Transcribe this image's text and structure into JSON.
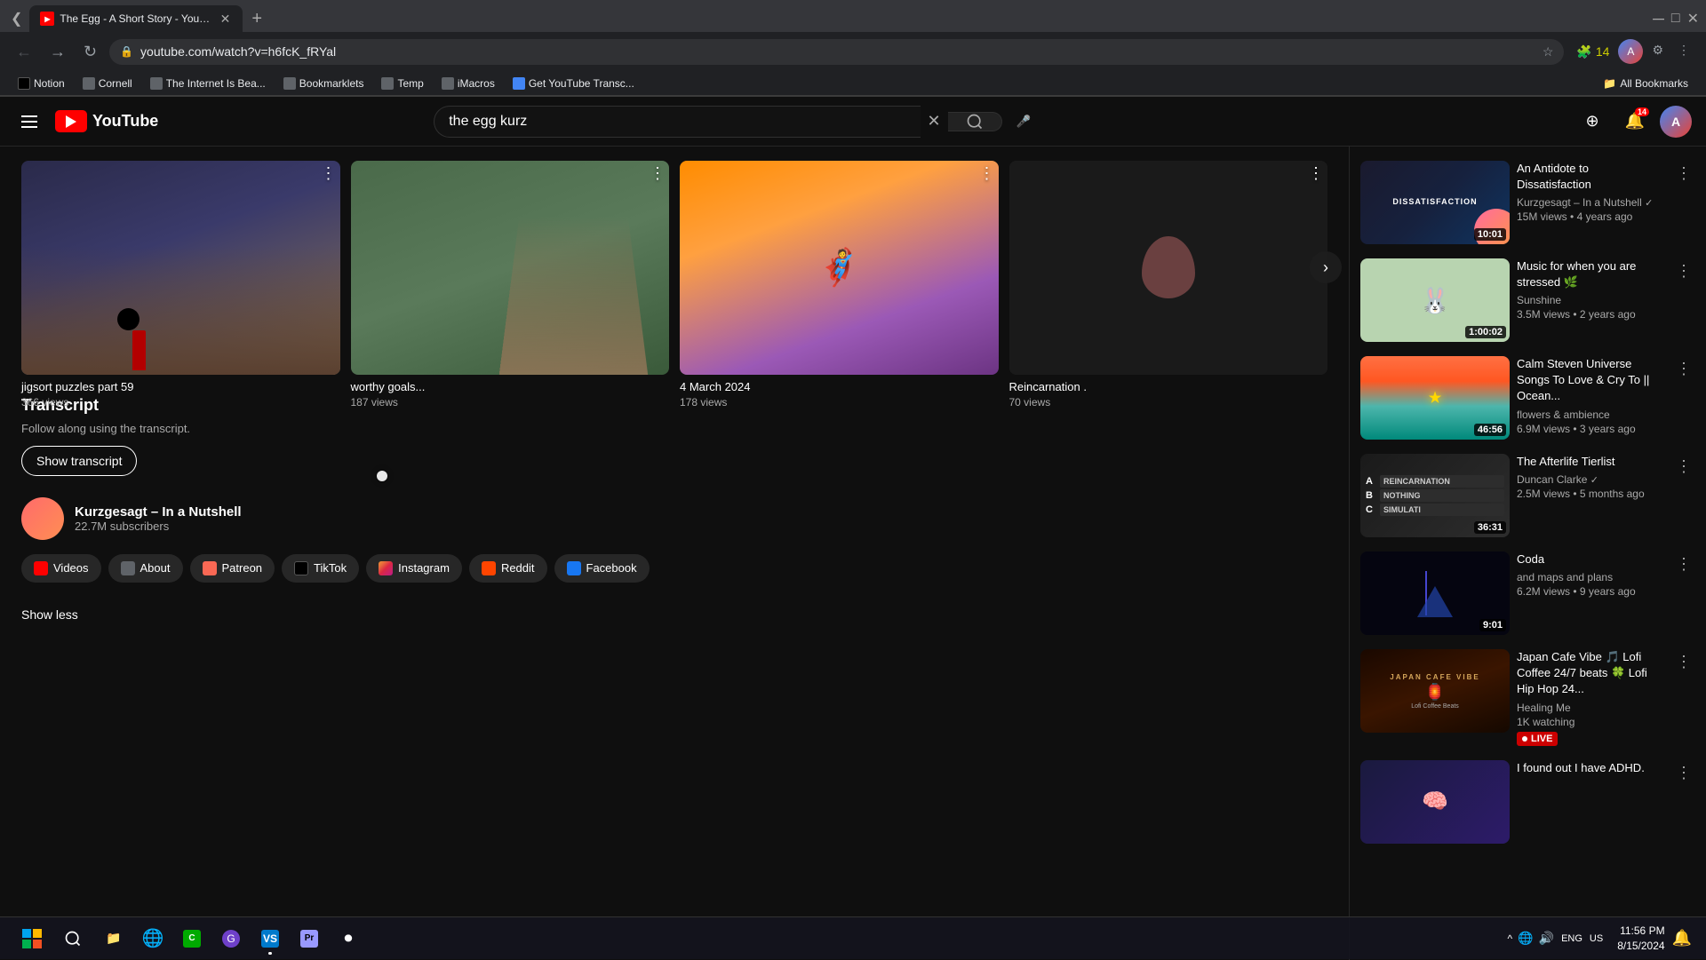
{
  "browser": {
    "tab_title": "The Egg - A Short Story - YouT...",
    "url": "youtube.com/watch?v=h6fcK_fRYal",
    "new_tab_label": "+",
    "bookmarks": [
      {
        "label": "Notion",
        "icon": "notion"
      },
      {
        "label": "Cornell",
        "icon": "folder"
      },
      {
        "label": "The Internet Is Bea...",
        "icon": "folder"
      },
      {
        "label": "Bookmarklets",
        "icon": "folder"
      },
      {
        "label": "Temp",
        "icon": "folder"
      },
      {
        "label": "iMacros",
        "icon": "folder"
      },
      {
        "label": "Get YouTube Transc...",
        "icon": "link"
      }
    ],
    "all_bookmarks_label": "All Bookmarks"
  },
  "youtube": {
    "search_query": "the egg kurz",
    "header_icons": {
      "create": "➕",
      "notifications": "🔔",
      "notification_count": "14",
      "avatar": "A"
    }
  },
  "thumbnails": [
    {
      "title": "jigsort puzzles part 59",
      "views": "366 views"
    },
    {
      "title": "worthy goals...",
      "views": "187 views"
    },
    {
      "title": "4 March 2024",
      "views": "178 views"
    },
    {
      "title": "Reincarnation .",
      "views": "70 views"
    }
  ],
  "transcript": {
    "title": "Transcript",
    "subtitle": "Follow along using the transcript.",
    "show_button": "Show transcript"
  },
  "channel": {
    "name": "Kurzgesagt – In a Nutshell",
    "subscribers": "22.7M subscribers",
    "links": [
      {
        "label": "Videos",
        "icon_class": "icon-videos"
      },
      {
        "label": "About",
        "icon_class": "icon-about"
      },
      {
        "label": "Patreon",
        "icon_class": "icon-patreon"
      },
      {
        "label": "TikTok",
        "icon_class": "icon-tiktok"
      },
      {
        "label": "Instagram",
        "icon_class": "icon-instagram"
      },
      {
        "label": "Reddit",
        "icon_class": "icon-reddit"
      },
      {
        "label": "Facebook",
        "icon_class": "icon-facebook"
      }
    ],
    "show_less_label": "Show less"
  },
  "sidebar_videos": [
    {
      "title": "An Antidote to Dissatisfaction",
      "channel": "Kurzgesagt – In a Nutshell",
      "verified": true,
      "views": "15M views",
      "age": "4 years ago",
      "duration": "10:01",
      "thumb_class": "dissatisfaction-thumb"
    },
    {
      "title": "Music for when you are stressed 🌿",
      "channel": "Sunshine",
      "verified": false,
      "views": "3.5M views",
      "age": "2 years ago",
      "duration": "1:00:02",
      "thumb_class": "stress-thumb"
    },
    {
      "title": "Calm Steven Universe Songs To Love & Cry To || Ocean...",
      "channel": "flowers & ambience",
      "verified": false,
      "views": "6.9M views",
      "age": "3 years ago",
      "duration": "46:56",
      "thumb_class": "steven-thumb"
    },
    {
      "title": "The Afterlife Tierlist",
      "channel": "Duncan Clarke",
      "verified": true,
      "views": "2.5M views",
      "age": "5 months ago",
      "duration": "36:31",
      "thumb_class": "afterlife-thumb"
    },
    {
      "title": "Coda",
      "channel": "and maps and plans",
      "verified": false,
      "views": "6.2M views",
      "age": "9 years ago",
      "duration": "9:01",
      "thumb_class": "coda-thumb"
    },
    {
      "title": "Japan Cafe Vibe 🎵 Lofi Coffee 24/7 beats 🍀 Lofi Hip Hop 24...",
      "channel": "Healing Me",
      "verified": false,
      "views": "1K watching",
      "age": "",
      "duration": "",
      "is_live": true,
      "thumb_class": "japan-thumb"
    },
    {
      "title": "I found out I have ADHD.",
      "channel": "",
      "verified": false,
      "views": "",
      "age": "",
      "duration": "",
      "thumb_class": "adhd-thumb"
    }
  ],
  "taskbar": {
    "time": "11:56 PM",
    "date": "8/15/2024",
    "language": "ENG",
    "region": "US"
  }
}
